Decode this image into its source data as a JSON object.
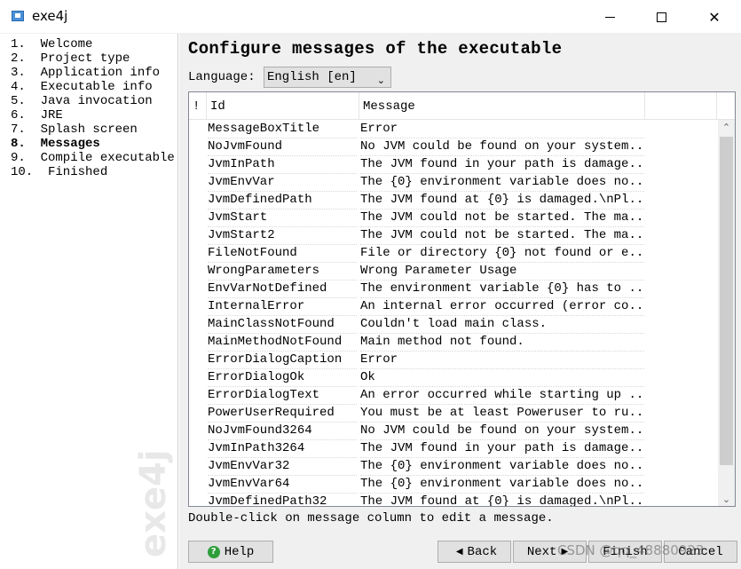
{
  "window": {
    "title": "exe4j",
    "icon": "exe4j-app-icon",
    "controls": {
      "minimize": "minimize-icon",
      "maximize": "maximize-icon",
      "close": "✕"
    }
  },
  "sidebar": {
    "steps": [
      {
        "label": "1.  Welcome",
        "active": false
      },
      {
        "label": "2.  Project type",
        "active": false
      },
      {
        "label": "3.  Application info",
        "active": false
      },
      {
        "label": "4.  Executable info",
        "active": false
      },
      {
        "label": "5.  Java invocation",
        "active": false
      },
      {
        "label": "6.  JRE",
        "active": false
      },
      {
        "label": "7.  Splash screen",
        "active": false
      },
      {
        "label": "8.  Messages",
        "active": true
      },
      {
        "label": "9.  Compile executable",
        "active": false
      },
      {
        "label": "10.  Finished",
        "active": false
      }
    ],
    "logo_text": "exe4j"
  },
  "main": {
    "header": "Configure messages of the executable",
    "language": {
      "label": "Language:",
      "selected": "English [en]"
    },
    "table": {
      "columns": [
        "!",
        "Id",
        "Message",
        ""
      ],
      "rows": [
        {
          "id": "MessageBoxTitle",
          "message": "Error"
        },
        {
          "id": "NoJvmFound",
          "message": "No JVM could be found on your system..."
        },
        {
          "id": "JvmInPath",
          "message": "The JVM found in your path is damage..."
        },
        {
          "id": "JvmEnvVar",
          "message": "The {0} environment variable does no..."
        },
        {
          "id": "JvmDefinedPath",
          "message": "The JVM found at {0} is damaged.\\nPl..."
        },
        {
          "id": "JvmStart",
          "message": "The JVM could not be started. The ma..."
        },
        {
          "id": "JvmStart2",
          "message": "The JVM could not be started. The ma..."
        },
        {
          "id": "FileNotFound",
          "message": "File or directory {0} not found or e..."
        },
        {
          "id": "WrongParameters",
          "message": "Wrong Parameter Usage"
        },
        {
          "id": "EnvVarNotDefined",
          "message": "The environment variable {0} has to ..."
        },
        {
          "id": "InternalError",
          "message": "An internal error occurred (error co..."
        },
        {
          "id": "MainClassNotFound",
          "message": "Couldn't load main class."
        },
        {
          "id": "MainMethodNotFound",
          "message": "Main method not found."
        },
        {
          "id": "ErrorDialogCaption",
          "message": "Error"
        },
        {
          "id": "ErrorDialogOk",
          "message": "Ok"
        },
        {
          "id": "ErrorDialogText",
          "message": "An error occurred while starting up ..."
        },
        {
          "id": "PowerUserRequired",
          "message": "You must be at least Poweruser to ru..."
        },
        {
          "id": "NoJvmFound3264",
          "message": "No JVM could be found on your system..."
        },
        {
          "id": "JvmInPath3264",
          "message": "The JVM found in your path is damage..."
        },
        {
          "id": "JvmEnvVar32",
          "message": "The {0} environment variable does no..."
        },
        {
          "id": "JvmEnvVar64",
          "message": "The {0} environment variable does no..."
        },
        {
          "id": "JvmDefinedPath32",
          "message": "The JVM found at {0} is damaged.\\nPl..."
        }
      ]
    },
    "hint": "Double-click on message column to edit a message."
  },
  "buttons": {
    "help": "Help",
    "back": "Back",
    "next": "Next",
    "finish": "Finish",
    "cancel": "Cancel"
  },
  "watermark": "CSDN @qq_48880923"
}
